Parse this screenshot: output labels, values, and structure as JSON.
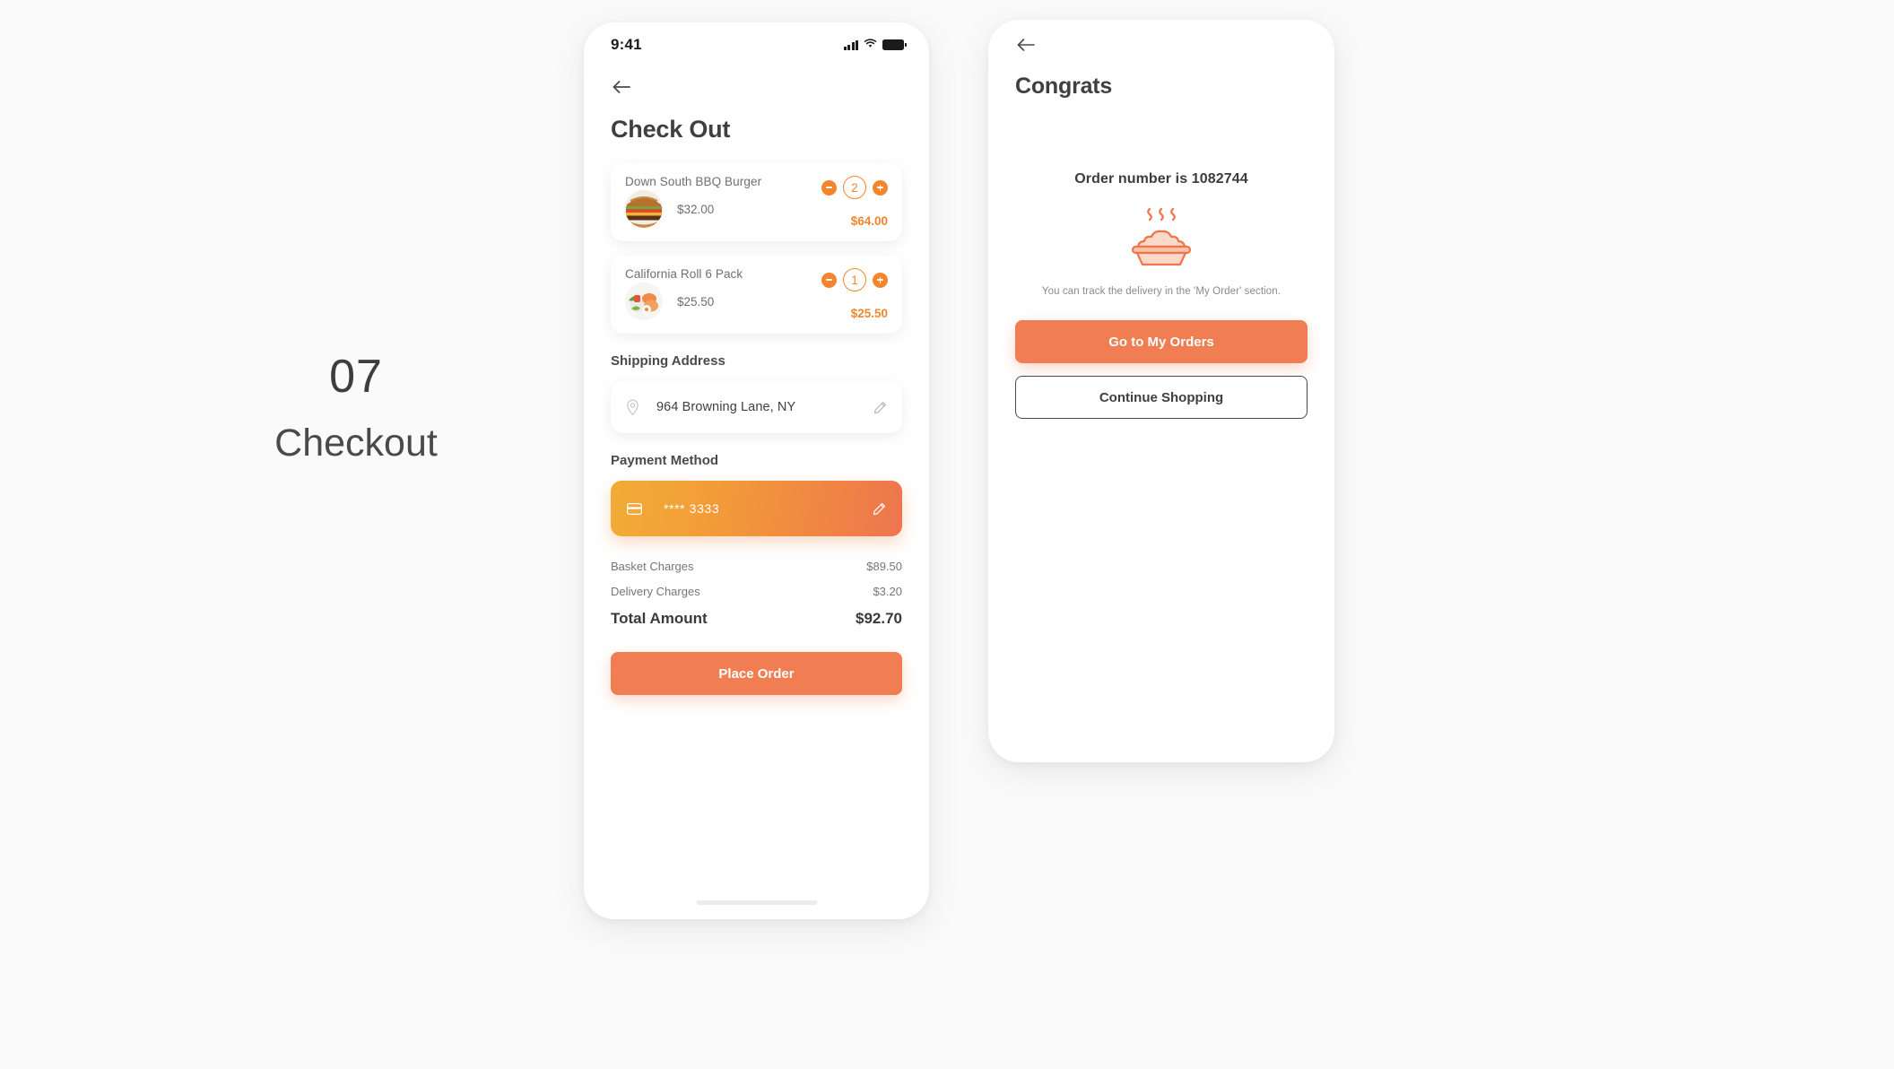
{
  "caption": {
    "number": "07",
    "label": "Checkout"
  },
  "colors": {
    "accent_orange": "#F07E52",
    "stepper_orange": "#F4852F",
    "card_gradient_start": "#F2AC36",
    "card_gradient_end": "#EE7550",
    "page_background": "#FAFAFA",
    "title_text": "#3F3F3F",
    "muted_text": "#767676"
  },
  "checkout_screen": {
    "status_bar": {
      "time": "9:41",
      "signal_icon": "signal-bars-icon",
      "wifi_icon": "wifi-icon",
      "battery_icon": "battery-full-icon"
    },
    "back_icon": "back-arrow-icon",
    "title": "Check Out",
    "cart_items": [
      {
        "name": "Down South BBQ Burger",
        "unit_price": "$32.00",
        "quantity": "2",
        "line_total": "$64.00",
        "thumbnail": "burger-thumbnail",
        "decrement_icon": "minus-icon",
        "increment_icon": "plus-icon"
      },
      {
        "name": "California Roll 6 Pack",
        "unit_price": "$25.50",
        "quantity": "1",
        "line_total": "$25.50",
        "thumbnail": "sushi-thumbnail",
        "decrement_icon": "minus-icon",
        "increment_icon": "plus-icon"
      }
    ],
    "shipping": {
      "section_title": "Shipping Address",
      "address": "964 Browning Lane, NY",
      "pin_icon": "location-pin-icon",
      "edit_icon": "pencil-edit-icon"
    },
    "payment": {
      "section_title": "Payment Method",
      "card_number": "**** 3333",
      "card_icon": "credit-card-icon",
      "edit_icon": "pencil-edit-icon"
    },
    "totals": [
      {
        "label": "Basket Charges",
        "value": "$89.50"
      },
      {
        "label": "Delivery Charges",
        "value": "$3.20"
      }
    ],
    "grand_total": {
      "label": "Total Amount",
      "value": "$92.70"
    },
    "place_order_label": "Place Order"
  },
  "congrats_screen": {
    "back_icon": "back-arrow-icon",
    "title": "Congrats",
    "order_number_text": "Order number is 1082744",
    "illustration": "steaming-food-bowl-icon",
    "track_note": "You can track the delivery in the 'My Order' section.",
    "primary_button_label": "Go to My Orders",
    "secondary_button_label": "Continue Shopping"
  }
}
